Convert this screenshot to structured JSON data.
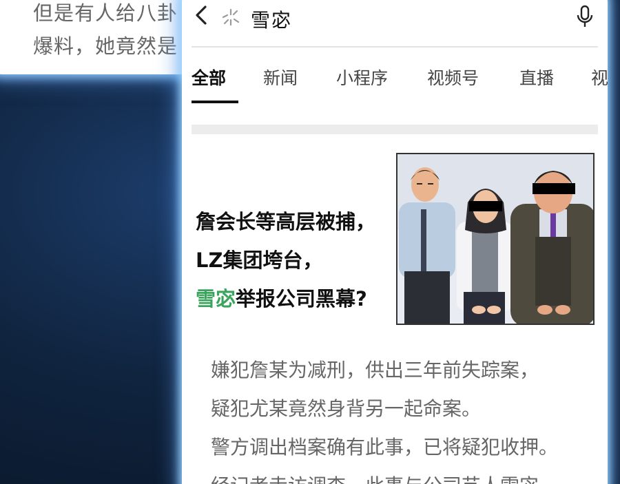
{
  "background_card": {
    "line1": "但是有人给八卦",
    "line2_prefix": "爆料，她竟然是",
    "line2_highlight": ""
  },
  "search": {
    "query": "雪宓",
    "back_icon": "chevron-left-icon",
    "ai_icon": "sparkle-icon",
    "mic_icon": "microphone-icon"
  },
  "tabs": [
    {
      "label": "全部",
      "active": true
    },
    {
      "label": "新闻",
      "active": false
    },
    {
      "label": "小程序",
      "active": false
    },
    {
      "label": "视频号",
      "active": false
    },
    {
      "label": "直播",
      "active": false
    },
    {
      "label": "视",
      "active": false
    }
  ],
  "article": {
    "headline_line1": "詹会长等高层被捕，",
    "headline_line2": "LZ集团垮台，",
    "headline_line3_name": "雪宓",
    "headline_line3_rest": "举报公司黑幕?",
    "body": [
      "嫌犯詹某为减刑，供出三年前失踪案，",
      "疑犯尤某竟然身背另一起命案。",
      "警方调出档案确有此事，已将疑犯收押。",
      "经记者走访调查，此事与公司艺人雪宓"
    ]
  },
  "colors": {
    "highlight_green": "#3aa45c",
    "glow": "#8cc8ff"
  }
}
